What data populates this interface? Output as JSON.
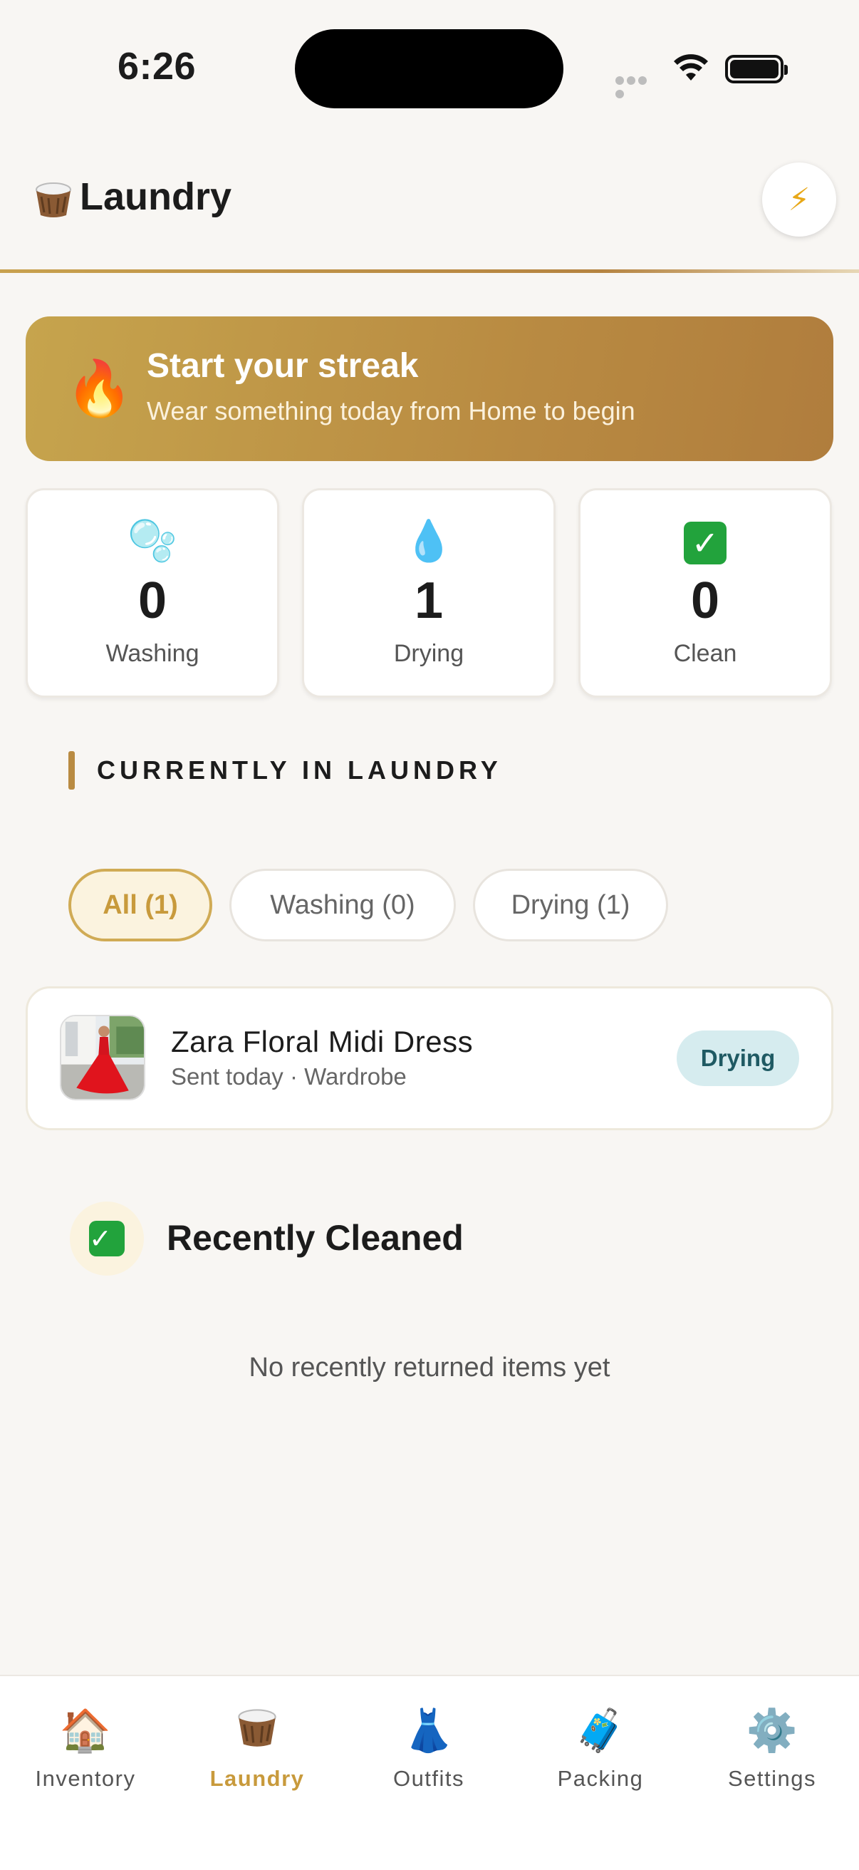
{
  "status_bar": {
    "time": "6:26"
  },
  "header": {
    "icon": "laundry-basket-icon",
    "title": "Laundry",
    "action_icon": "bolt-icon"
  },
  "streak": {
    "icon": "flame-icon",
    "title": "Start your streak",
    "subtitle": "Wear something today from Home to begin"
  },
  "stats": [
    {
      "icon": "bubbles-icon",
      "value": "0",
      "label": "Washing"
    },
    {
      "icon": "droplet-icon",
      "value": "1",
      "label": "Drying"
    },
    {
      "icon": "check-icon",
      "value": "0",
      "label": "Clean"
    }
  ],
  "section": {
    "title": "CURRENTLY IN LAUNDRY"
  },
  "filters": [
    {
      "label": "All (1)",
      "active": true
    },
    {
      "label": "Washing (0)",
      "active": false
    },
    {
      "label": "Drying (1)",
      "active": false
    }
  ],
  "items": [
    {
      "name": "Zara Floral Midi Dress",
      "meta": "Sent today · Wardrobe",
      "status": "Drying"
    }
  ],
  "recently_cleaned": {
    "title": "Recently Cleaned",
    "empty_message": "No recently returned items yet"
  },
  "tabs": [
    {
      "label": "Inventory",
      "icon": "house-icon",
      "active": false
    },
    {
      "label": "Laundry",
      "icon": "basket-icon",
      "active": true
    },
    {
      "label": "Outfits",
      "icon": "dress-icon",
      "active": false
    },
    {
      "label": "Packing",
      "icon": "suitcase-icon",
      "active": false
    },
    {
      "label": "Settings",
      "icon": "gear-icon",
      "active": false
    }
  ],
  "colors": {
    "accent": "#c89a3c",
    "background": "#f8f6f3",
    "badge_bg": "#d6ecef"
  }
}
